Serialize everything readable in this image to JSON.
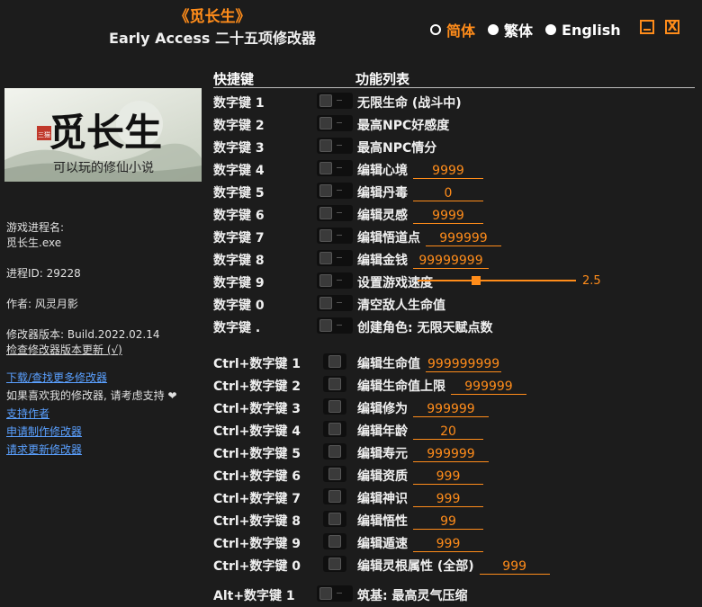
{
  "header": {
    "game_title": "《觅长生》",
    "subtitle": "Early Access 二十五项修改器"
  },
  "languages": [
    {
      "label": "简体",
      "selected": true
    },
    {
      "label": "繁体",
      "selected": false
    },
    {
      "label": "English",
      "selected": false
    }
  ],
  "window": {
    "close_glyph": "X"
  },
  "columns": {
    "hotkey": "快捷键",
    "function": "功能列表"
  },
  "banner": {
    "title": "觅长生",
    "seal": "三猫",
    "tagline": "可以玩的修仙小说"
  },
  "info": {
    "process_label": "游戏进程名:",
    "process_name": "觅长生.exe",
    "pid": "进程ID: 29228",
    "author": "作者: 风灵月影",
    "version": "修改器版本: Build.2022.02.14",
    "check_update": "检查修改器版本更新 (√)",
    "links": {
      "download": "下载/查找更多修改器",
      "support_text": "如果喜欢我的修改器, 请考虑支持 ❤",
      "support": "支持作者",
      "request": "申请制作修改器",
      "request_update": "请求更新修改器"
    }
  },
  "rows": [
    {
      "hotkey": "数字键 1",
      "label": "无限生命 (战斗中)",
      "value": ""
    },
    {
      "hotkey": "数字键 2",
      "label": "最高NPC好感度",
      "value": ""
    },
    {
      "hotkey": "数字键 3",
      "label": "最高NPC情分",
      "value": ""
    },
    {
      "hotkey": "数字键 4",
      "label": "编辑心境",
      "value": "9999"
    },
    {
      "hotkey": "数字键 5",
      "label": "编辑丹毒",
      "value": "0"
    },
    {
      "hotkey": "数字键 6",
      "label": "编辑灵感",
      "value": "9999"
    },
    {
      "hotkey": "数字键 7",
      "label": "编辑悟道点",
      "value": "999999"
    },
    {
      "hotkey": "数字键 8",
      "label": "编辑金钱",
      "value": "99999999"
    },
    {
      "hotkey": "数字键 9",
      "label": "设置游戏速度",
      "value": ""
    },
    {
      "hotkey": "数字键 0",
      "label": "清空敌人生命值",
      "value": ""
    },
    {
      "hotkey": "数字键 .",
      "label": "创建角色: 无限天赋点数",
      "value": ""
    },
    {
      "hotkey": "Ctrl+数字键 1",
      "label": "编辑生命值",
      "value": "999999999"
    },
    {
      "hotkey": "Ctrl+数字键 2",
      "label": "编辑生命值上限",
      "value": "999999"
    },
    {
      "hotkey": "Ctrl+数字键 3",
      "label": "编辑修为",
      "value": "999999"
    },
    {
      "hotkey": "Ctrl+数字键 4",
      "label": "编辑年龄",
      "value": "20"
    },
    {
      "hotkey": "Ctrl+数字键 5",
      "label": "编辑寿元",
      "value": "999999"
    },
    {
      "hotkey": "Ctrl+数字键 6",
      "label": "编辑资质",
      "value": "999"
    },
    {
      "hotkey": "Ctrl+数字键 7",
      "label": "编辑神识",
      "value": "999"
    },
    {
      "hotkey": "Ctrl+数字键 8",
      "label": "编辑悟性",
      "value": "99"
    },
    {
      "hotkey": "Ctrl+数字键 9",
      "label": "编辑遁速",
      "value": "999"
    },
    {
      "hotkey": "Ctrl+数字键 0",
      "label": "编辑灵根属性 (全部)",
      "value": "999"
    },
    {
      "hotkey": "Alt+数字键 1",
      "label": "筑基: 最高灵气压缩",
      "value": ""
    }
  ],
  "speed": {
    "value": "2.5",
    "fraction": 0.37
  },
  "colors": {
    "accent": "#ff8c1a",
    "link": "#5aa0ff",
    "background": "#1c1c1c"
  }
}
